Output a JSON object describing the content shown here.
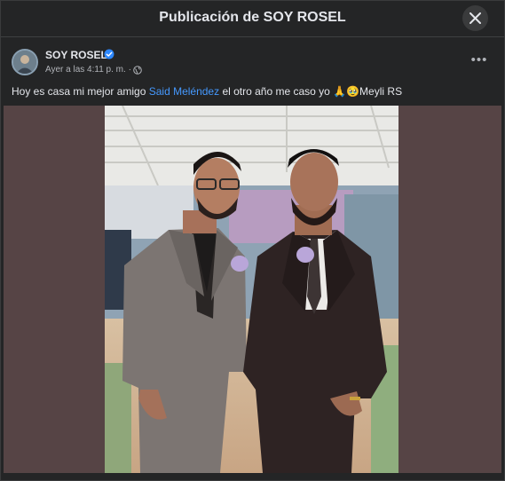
{
  "modal": {
    "title": "Publicación de SOY ROSEL"
  },
  "post": {
    "author": "SOY ROSEL",
    "timestamp": "Ayer a las 4:11 p. m. ·",
    "text_before": "Hoy es casa mi mejor amigo ",
    "mention": "Said Meléndez",
    "text_after": " el otro año me caso yo 🙏🥹Meyli RS"
  },
  "icons": {
    "close": "close-icon",
    "verified": "verified-badge-icon",
    "privacy": "globe-icon",
    "more": "more-options-icon"
  },
  "colors": {
    "background": "#242526",
    "mention": "#4599ff",
    "verified": "#2d88ff",
    "media_backdrop": "#564445"
  }
}
